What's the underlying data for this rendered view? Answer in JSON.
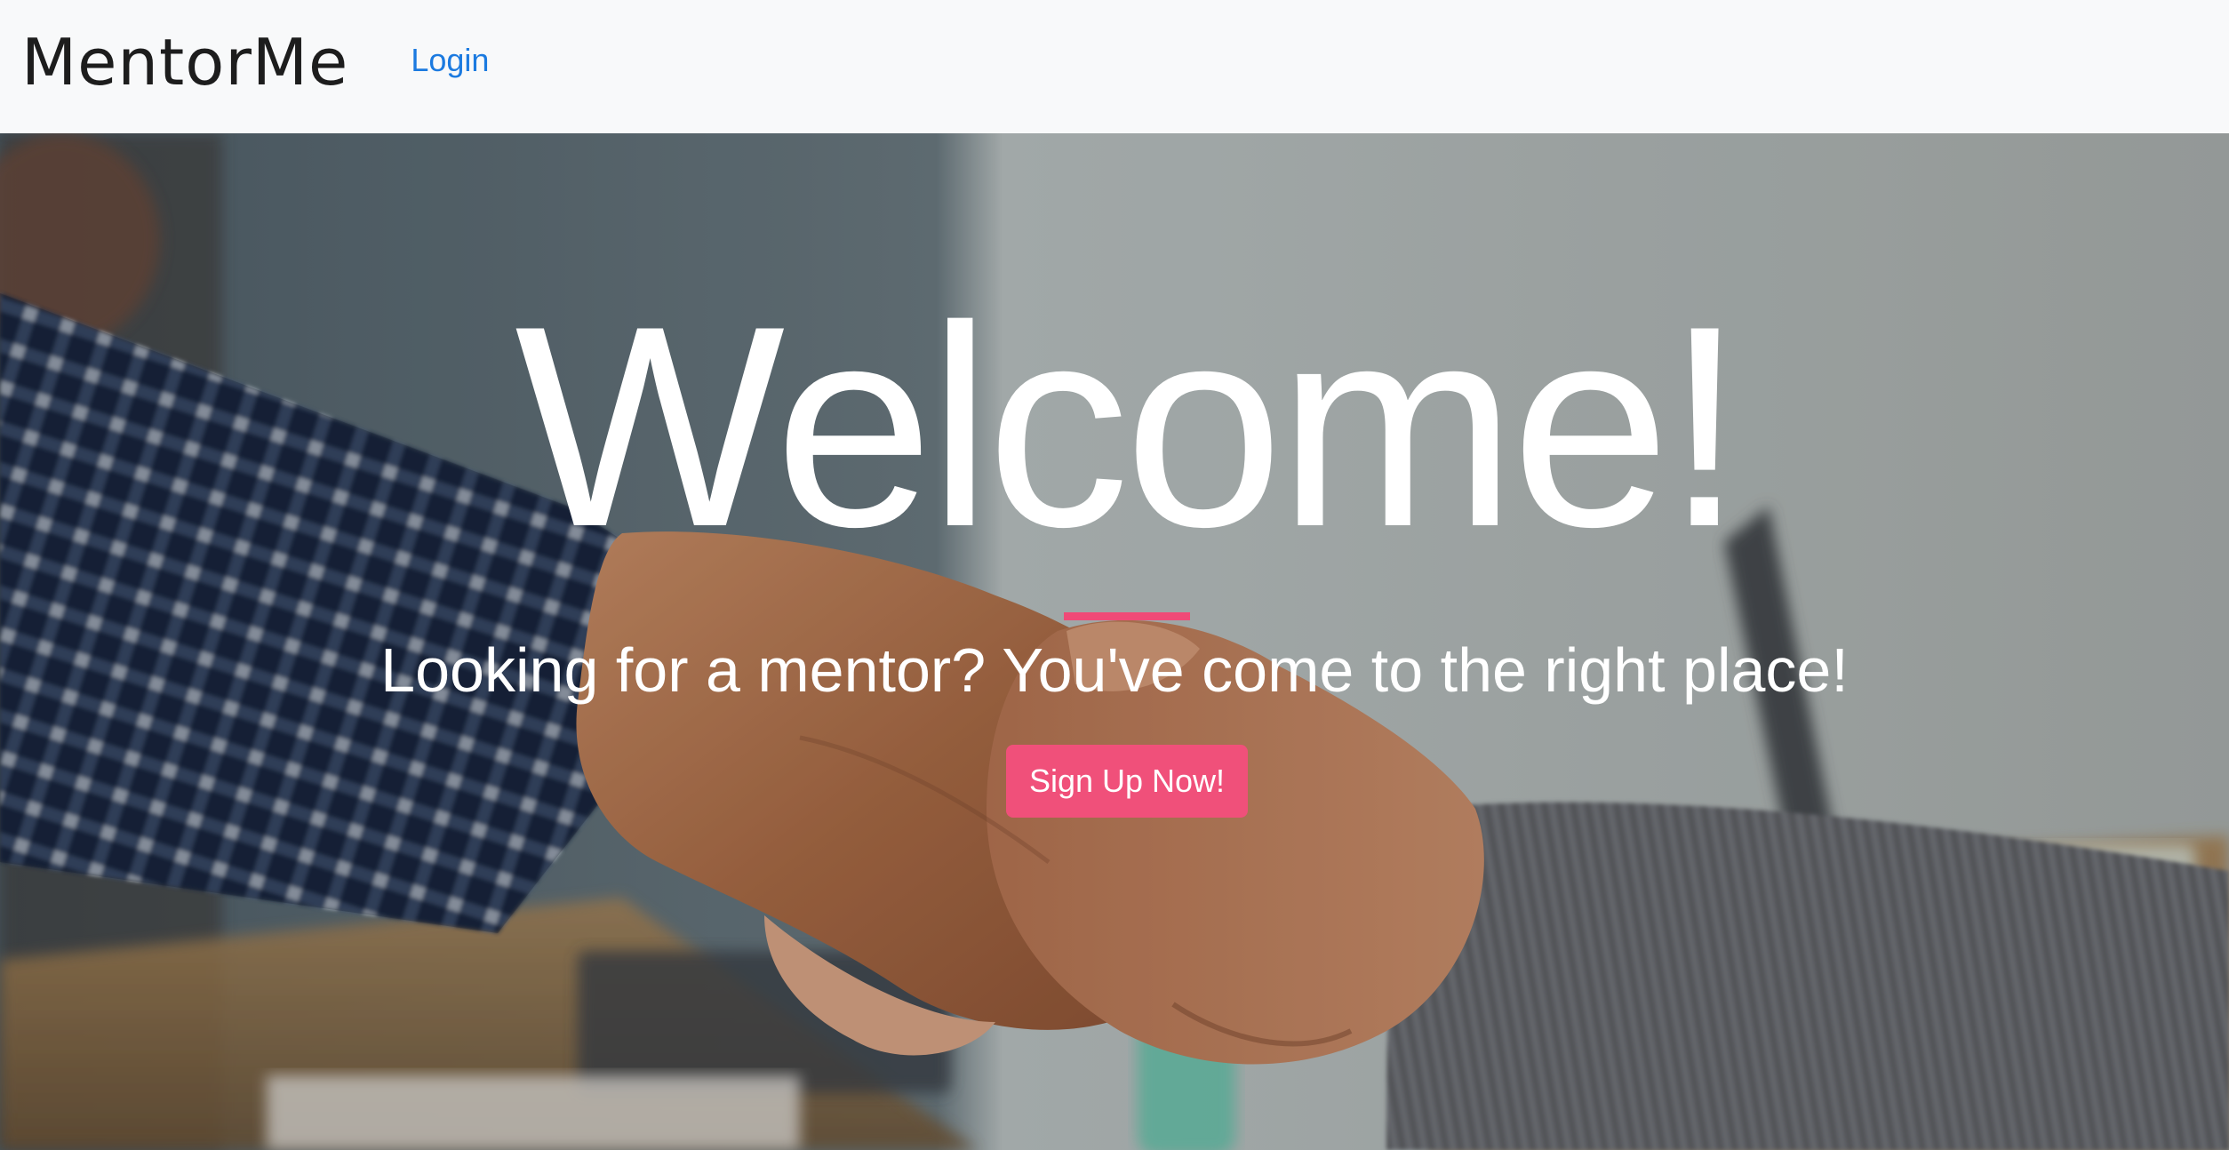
{
  "navbar": {
    "brand": "MentorMe",
    "login_label": "Login"
  },
  "hero": {
    "heading": "Welcome!",
    "tagline": "Looking for a mentor? You've come to the right place!",
    "cta_label": "Sign Up Now!",
    "background_image": "handshake-photo"
  },
  "colors": {
    "navbar_bg": "#f8f9fa",
    "link": "#1b7ae0",
    "accent": "#f0507a",
    "text_on_hero": "#ffffff"
  }
}
